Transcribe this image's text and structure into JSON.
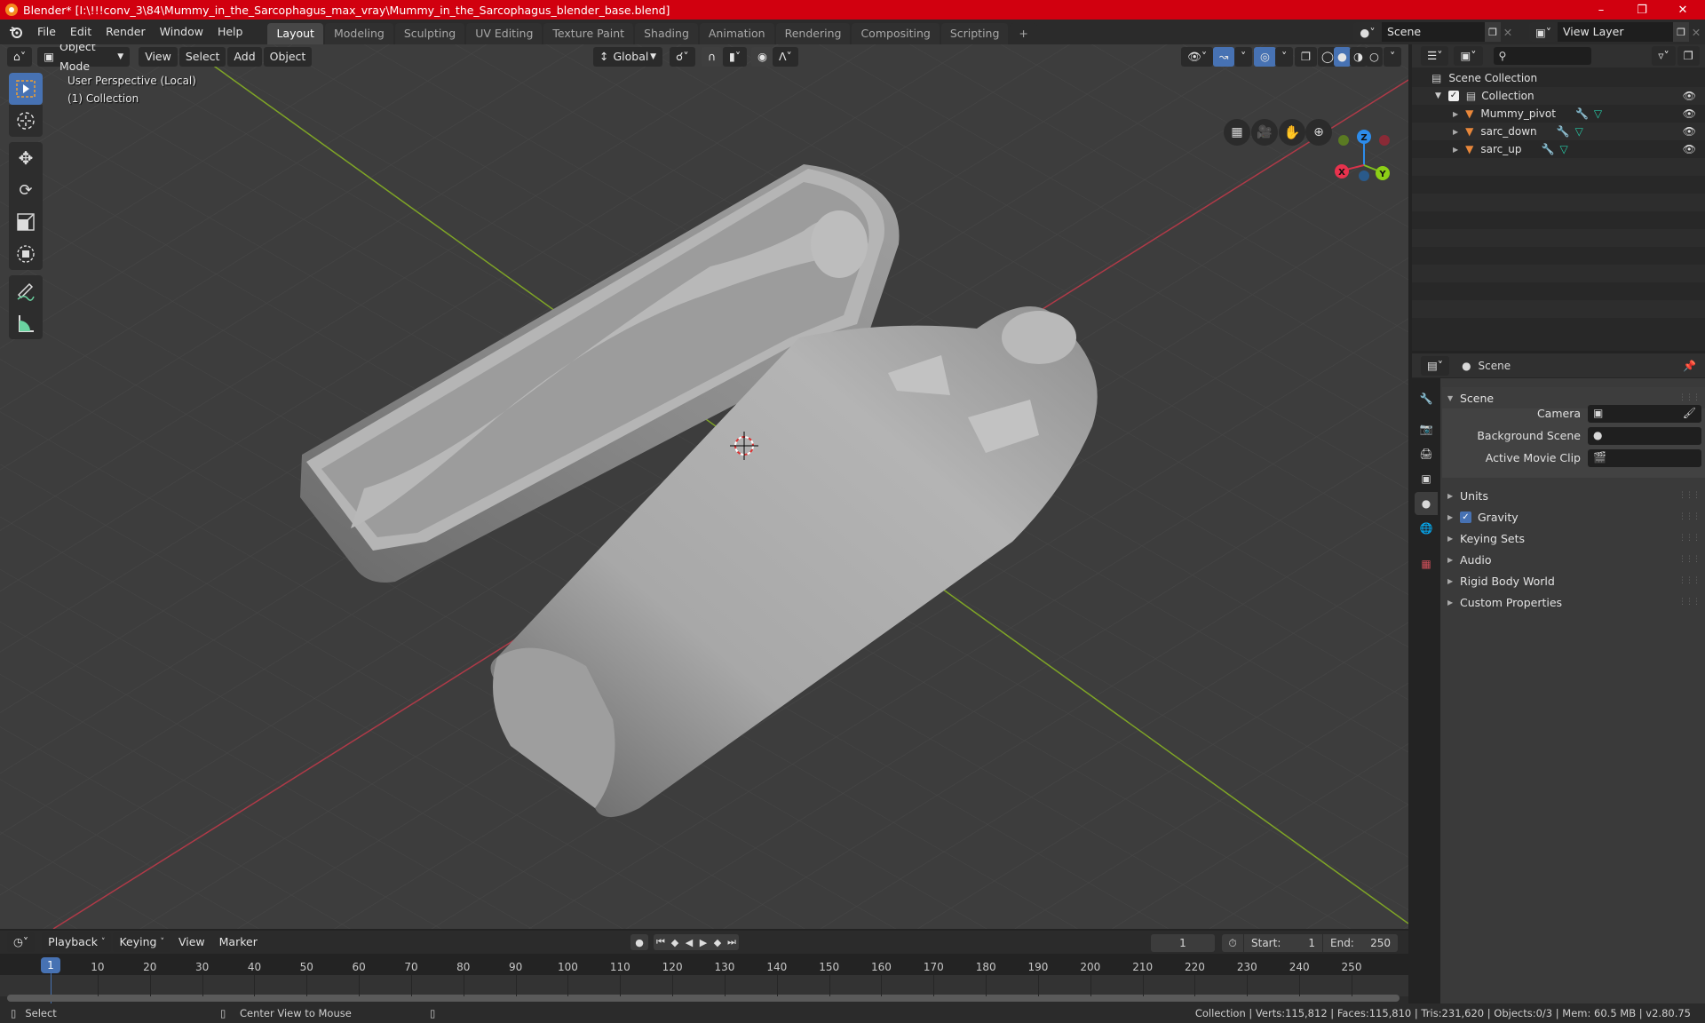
{
  "window": {
    "title": "Blender* [I:\\!!!conv_3\\84\\Mummy_in_the_Sarcophagus_max_vray\\Mummy_in_the_Sarcophagus_blender_base.blend]",
    "controls": [
      "minimize",
      "maximize",
      "close"
    ]
  },
  "menubar": {
    "menus": [
      "File",
      "Edit",
      "Render",
      "Window",
      "Help"
    ],
    "workspaces": [
      "Layout",
      "Modeling",
      "Sculpting",
      "UV Editing",
      "Texture Paint",
      "Shading",
      "Animation",
      "Rendering",
      "Compositing",
      "Scripting"
    ],
    "active_workspace": "Layout",
    "add_workspace": "+",
    "scene": "Scene",
    "view_layer": "View Layer"
  },
  "viewport": {
    "header": {
      "mode": "Object Mode",
      "menus": [
        "View",
        "Select",
        "Add",
        "Object"
      ],
      "orientation": "Global"
    },
    "info_line1": "User Perspective (Local)",
    "info_line2": "(1) Collection",
    "gizmo_axes": [
      "X",
      "Y",
      "Z"
    ],
    "colors": {
      "x_axis": "#d8334a",
      "y_axis": "#7fbf1f",
      "z_axis": "#2d8ceb",
      "grid_bg": "#3d3d3d",
      "active_blue": "#4772b3"
    },
    "tools": [
      "select-box",
      "cursor",
      "move",
      "rotate",
      "scale",
      "transform",
      "annotate",
      "measure"
    ]
  },
  "outliner": {
    "root": "Scene Collection",
    "collection": "Collection",
    "objects": [
      {
        "name": "Mummy_pivot"
      },
      {
        "name": "sarc_down"
      },
      {
        "name": "sarc_up"
      }
    ]
  },
  "properties": {
    "context": "Scene",
    "section": "Scene",
    "fields": [
      {
        "label": "Camera",
        "value": ""
      },
      {
        "label": "Background Scene",
        "value": ""
      },
      {
        "label": "Active Movie Clip",
        "value": ""
      }
    ],
    "panels": [
      "Units",
      "Gravity",
      "Keying Sets",
      "Audio",
      "Rigid Body World",
      "Custom Properties"
    ],
    "gravity_checked": true
  },
  "timeline": {
    "menus": [
      "Playback",
      "Keying",
      "View",
      "Marker"
    ],
    "current_frame": "1",
    "start_label": "Start:",
    "start": "1",
    "end_label": "End:",
    "end": "250",
    "ticks": [
      "10",
      "20",
      "30",
      "40",
      "50",
      "60",
      "70",
      "80",
      "90",
      "100",
      "110",
      "120",
      "130",
      "140",
      "150",
      "160",
      "170",
      "180",
      "190",
      "200",
      "210",
      "220",
      "230",
      "240",
      "250"
    ],
    "playhead": "1"
  },
  "status": {
    "left_action": "Select",
    "middle_action": "Center View to Mouse",
    "stats": "Collection | Verts:115,812 | Faces:115,810 | Tris:231,620 | Objects:0/3 | Mem: 60.5 MB | v2.80.75"
  }
}
